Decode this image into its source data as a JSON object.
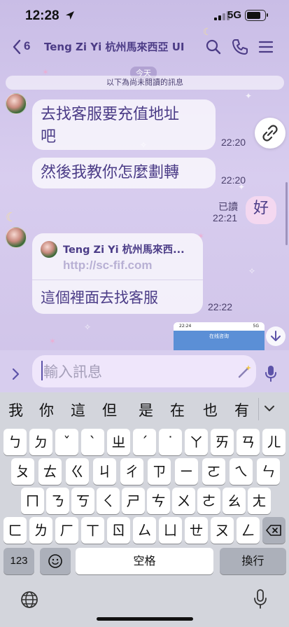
{
  "status_bar": {
    "time": "12:28",
    "network": "5G",
    "battery_level": 0.8
  },
  "header": {
    "back_count": "6",
    "title": "Teng Zi Yi 杭州馬來西亞 UI"
  },
  "chat": {
    "date": "今天",
    "unread_notice": "以下為尚未閱讀的訊息",
    "messages": [
      {
        "text_lines": [
          "去找客服要充值地址",
          "吧"
        ],
        "time": "22:20"
      },
      {
        "text": "然後我教你怎麼劃轉",
        "time": "22:20"
      },
      {
        "text": "好",
        "time": "22:21",
        "read": "已讀"
      },
      {
        "card_name": "Teng Zi Yi 杭州馬來西...",
        "card_url": "http://sc-fif.com",
        "text": "這個裡面去找客服",
        "time": "22:22"
      }
    ],
    "preview": {
      "time": "22:24",
      "title": "在线咨询",
      "network": "5G"
    }
  },
  "input": {
    "placeholder": "輸入訊息"
  },
  "keyboard": {
    "suggestions": [
      "我",
      "你",
      "這",
      "但",
      "是",
      "在",
      "也",
      "有"
    ],
    "rows": [
      [
        "ㄅ",
        "ㄉ",
        "ˇ",
        "ˋ",
        "ㄓ",
        "ˊ",
        "˙",
        "ㄚ",
        "ㄞ",
        "ㄢ",
        "ㄦ"
      ],
      [
        "ㄆ",
        "ㄊ",
        "ㄍ",
        "ㄐ",
        "ㄔ",
        "ㄗ",
        "ㄧ",
        "ㄛ",
        "ㄟ",
        "ㄣ"
      ],
      [
        "ㄇ",
        "ㄋ",
        "ㄎ",
        "ㄑ",
        "ㄕ",
        "ㄘ",
        "ㄨ",
        "ㄜ",
        "ㄠ",
        "ㄤ"
      ],
      [
        "ㄈ",
        "ㄌ",
        "ㄏ",
        "ㄒ",
        "ㄖ",
        "ㄙ",
        "ㄩ",
        "ㄝ",
        "ㄡ",
        "ㄥ"
      ]
    ],
    "numbers_label": "123",
    "space_label": "空格",
    "return_label": "換行"
  }
}
